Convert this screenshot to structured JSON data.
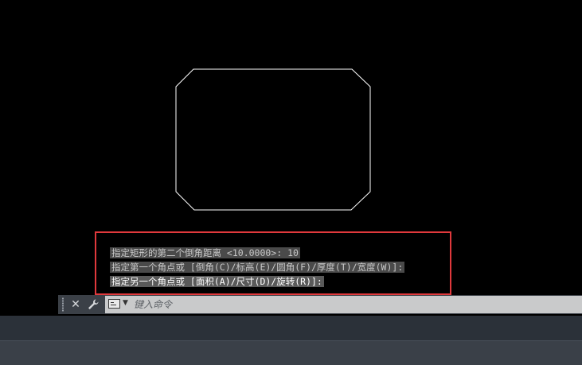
{
  "drawing": {
    "shape": "chamfered-rectangle",
    "stroke_color": "#ffffff"
  },
  "command_history": {
    "lines": [
      "指定矩形的第二个倒角距离 <10.0000>: 10",
      "指定第一个角点或 [倒角(C)/标高(E)/圆角(F)/厚度(T)/宽度(W)]:",
      "指定另一个角点或 [面积(A)/尺寸(D)/旋转(R)]:"
    ],
    "highlight_color": "#e0393c"
  },
  "command_line": {
    "close_icon": "✕",
    "customize_icon": "wrench-icon",
    "prompt_icon": "command-prompt-icon",
    "placeholder": "键入命令"
  }
}
